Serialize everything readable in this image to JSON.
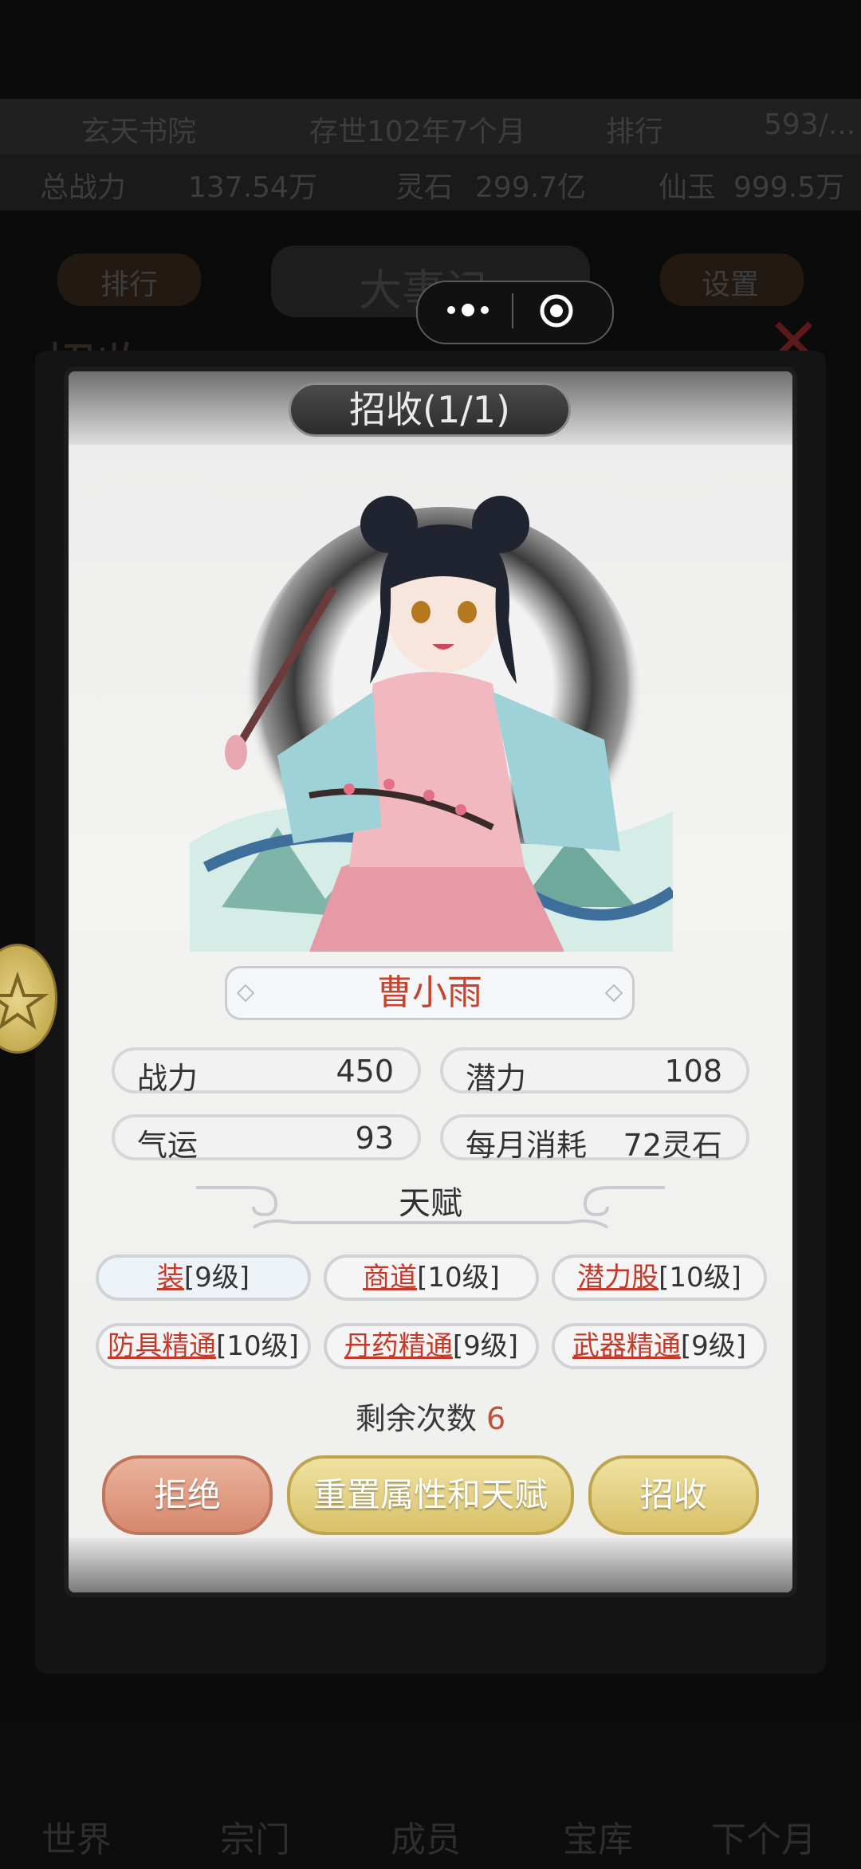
{
  "background": {
    "sect_name": "玄天书院",
    "existence": "存世102年7个月",
    "rank_label": "排行",
    "rank_value": "593/...",
    "total_power_label": "总战力",
    "total_power_value": "137.54万",
    "spirit_stone_label": "灵石",
    "spirit_stone_value": "299.7亿",
    "immortal_label": "仙玉",
    "immortal_value": "999.5万",
    "left_button": "排行",
    "center_banner": "大事记",
    "right_button": "设置",
    "panel_title": "招收",
    "nav": [
      "世界",
      "宗门",
      "成员",
      "宝库",
      "下个月"
    ]
  },
  "modal": {
    "title": "招收(1/1)",
    "character_name": "曹小雨",
    "stats": [
      {
        "label": "战力",
        "value": "450"
      },
      {
        "label": "潜力",
        "value": "108"
      },
      {
        "label": "气运",
        "value": "93"
      },
      {
        "label": "每月消耗",
        "value": "72灵石"
      }
    ],
    "talent_heading": "天赋",
    "talents": [
      {
        "name": "装",
        "level": "[9级]"
      },
      {
        "name": "商道",
        "level": "[10级]"
      },
      {
        "name": "潜力股",
        "level": "[10级]"
      },
      {
        "name": "防具精通",
        "level": "[10级]"
      },
      {
        "name": "丹药精通",
        "level": "[9级]"
      },
      {
        "name": "武器精通",
        "level": "[9级]"
      }
    ],
    "remaining_label": "剩余次数",
    "remaining_value": "6",
    "buttons": {
      "reject": "拒绝",
      "reset": "重置属性和天赋",
      "recruit": "招收"
    }
  },
  "colors": {
    "accent_red": "#c33a2a",
    "gold_button": "#d8c169",
    "red_button": "#d6886d"
  }
}
